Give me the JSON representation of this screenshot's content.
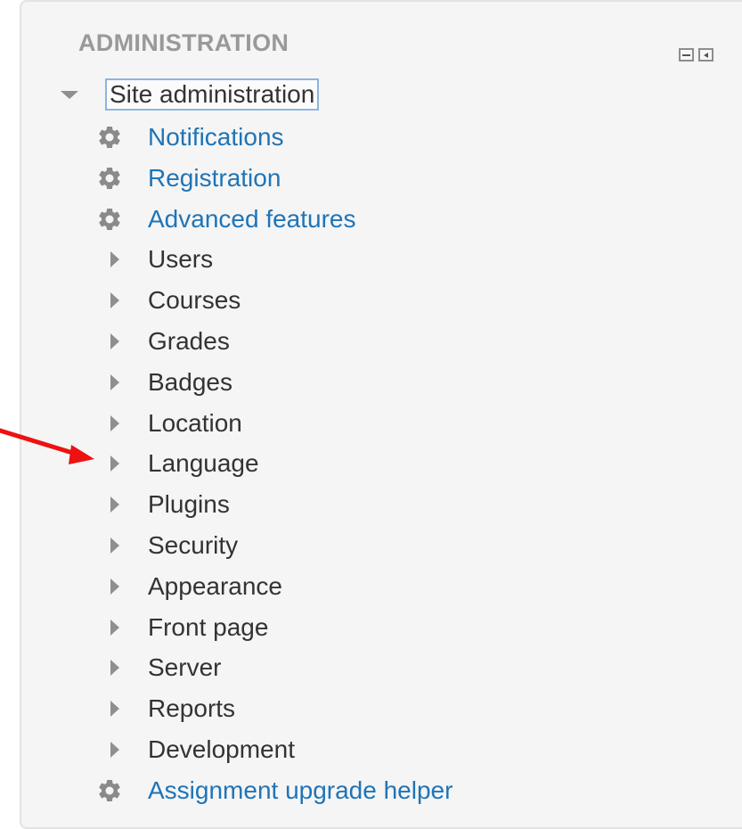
{
  "block": {
    "title": "ADMINISTRATION",
    "controls": [
      {
        "name": "hide-block-button",
        "icon": "minus-icon"
      },
      {
        "name": "dock-block-button",
        "icon": "dock-arrow-icon"
      }
    ]
  },
  "tree": {
    "root_label": "Site administration",
    "root_expanded": true,
    "items": [
      {
        "label": "Notifications",
        "type": "link",
        "icon": "gear-icon"
      },
      {
        "label": "Registration",
        "type": "link",
        "icon": "gear-icon"
      },
      {
        "label": "Advanced features",
        "type": "link",
        "icon": "gear-icon"
      },
      {
        "label": "Users",
        "type": "branch",
        "icon": "expand-arrow-icon"
      },
      {
        "label": "Courses",
        "type": "branch",
        "icon": "expand-arrow-icon"
      },
      {
        "label": "Grades",
        "type": "branch",
        "icon": "expand-arrow-icon"
      },
      {
        "label": "Badges",
        "type": "branch",
        "icon": "expand-arrow-icon"
      },
      {
        "label": "Location",
        "type": "branch",
        "icon": "expand-arrow-icon"
      },
      {
        "label": "Language",
        "type": "branch",
        "icon": "expand-arrow-icon"
      },
      {
        "label": "Plugins",
        "type": "branch",
        "icon": "expand-arrow-icon"
      },
      {
        "label": "Security",
        "type": "branch",
        "icon": "expand-arrow-icon"
      },
      {
        "label": "Appearance",
        "type": "branch",
        "icon": "expand-arrow-icon"
      },
      {
        "label": "Front page",
        "type": "branch",
        "icon": "expand-arrow-icon"
      },
      {
        "label": "Server",
        "type": "branch",
        "icon": "expand-arrow-icon"
      },
      {
        "label": "Reports",
        "type": "branch",
        "icon": "expand-arrow-icon"
      },
      {
        "label": "Development",
        "type": "branch",
        "icon": "expand-arrow-icon"
      },
      {
        "label": "Assignment upgrade helper",
        "type": "link",
        "icon": "gear-icon"
      }
    ]
  },
  "annotation": {
    "icon": "red-arrow-pointer",
    "points_to": "Language",
    "color": "#ee1111"
  },
  "colors": {
    "link": "#1f74b7",
    "text": "#333333",
    "title": "#999999",
    "panel_bg": "#f5f5f5"
  }
}
